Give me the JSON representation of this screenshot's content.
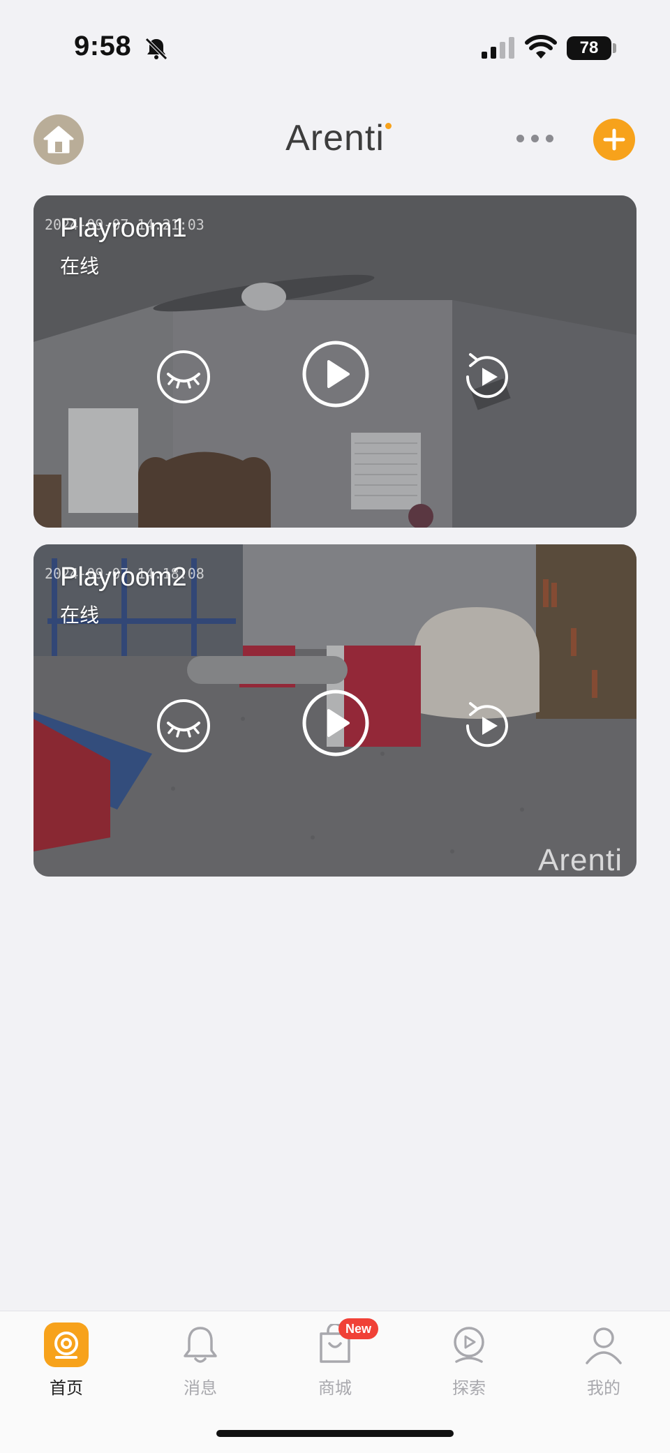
{
  "status_bar": {
    "time": "9:58",
    "battery": "78"
  },
  "header": {
    "brand": "Arenti"
  },
  "cameras": [
    {
      "name": "Playroom1",
      "status": "在线",
      "timestamp": "2024-09-07 14:21:03"
    },
    {
      "name": "Playroom2",
      "status": "在线",
      "timestamp": "2024-09-07 14:18:08",
      "watermark": "Arenti"
    }
  ],
  "tabs": [
    {
      "label": "首页",
      "icon": "camera-home-icon",
      "active": true
    },
    {
      "label": "消息",
      "icon": "bell-icon",
      "active": false
    },
    {
      "label": "商城",
      "icon": "shopping-bag-icon",
      "active": false,
      "badge": "New"
    },
    {
      "label": "探索",
      "icon": "explore-camera-icon",
      "active": false
    },
    {
      "label": "我的",
      "icon": "profile-icon",
      "active": false
    }
  ],
  "colors": {
    "accent": "#f7a21b",
    "background": "#f2f2f5",
    "badge": "#f04137",
    "home_button": "#b9ad98"
  }
}
